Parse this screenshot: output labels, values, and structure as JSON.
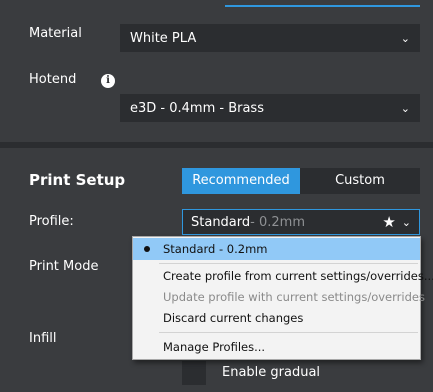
{
  "material": {
    "label": "Material",
    "value": "White PLA"
  },
  "hotend": {
    "label": "Hotend",
    "value": "e3D - 0.4mm - Brass",
    "info_icon": "info-icon"
  },
  "print_setup": {
    "title": "Print Setup",
    "tabs": [
      {
        "label": "Recommended",
        "active": true
      },
      {
        "label": "Custom",
        "active": false
      }
    ],
    "profile": {
      "label": "Profile:",
      "name": "Standard",
      "detail": " - 0.2mm"
    },
    "print_mode_label": "Print Mode",
    "infill_label": "Infill",
    "enable_gradual_label": "Enable gradual"
  },
  "profile_menu": {
    "items": [
      {
        "label": "Standard - 0.2mm",
        "selected": true,
        "disabled": false
      },
      {
        "label": "Create profile from current settings/overrides...",
        "selected": false,
        "disabled": false
      },
      {
        "label": "Update profile with current settings/overrides",
        "selected": false,
        "disabled": true
      },
      {
        "label": "Discard current changes",
        "selected": false,
        "disabled": false
      },
      {
        "label": "Manage Profiles...",
        "selected": false,
        "disabled": false
      }
    ]
  },
  "colors": {
    "accent": "#2f97de",
    "panel_bg": "#3a3c3f",
    "control_bg": "#2b2d30",
    "menu_selected": "#91c9f7"
  }
}
